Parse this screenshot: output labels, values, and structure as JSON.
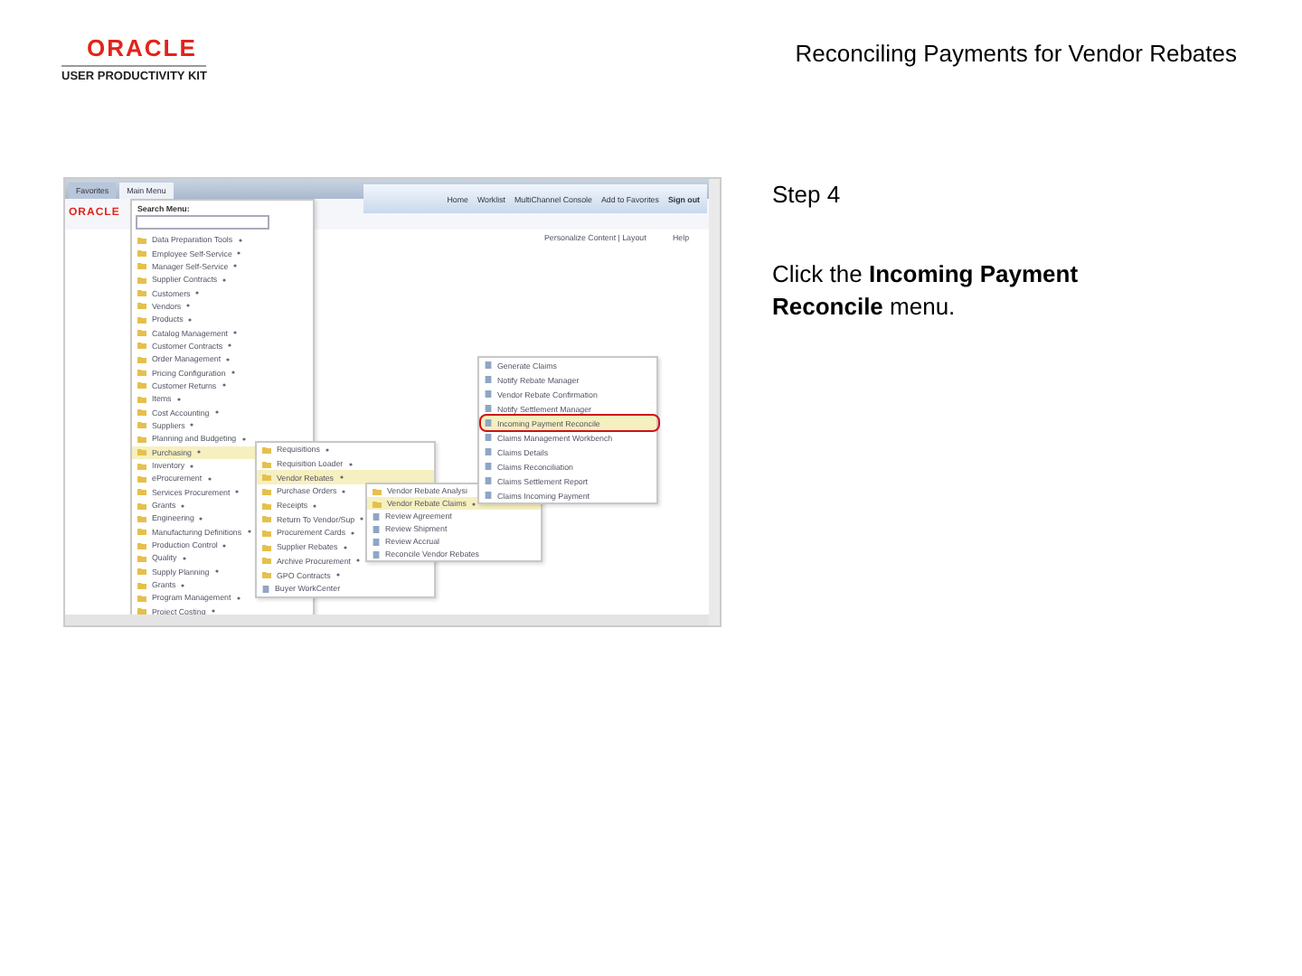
{
  "header": {
    "brand": "ORACLE",
    "product": "USER PRODUCTIVITY KIT",
    "title": "Reconciling Payments for Vendor Rebates"
  },
  "screenshot": {
    "nav_tabs": [
      {
        "label": "Favorites",
        "selected": false
      },
      {
        "label": "Main Menu",
        "selected": true
      }
    ],
    "brand": "ORACLE",
    "header_links": [
      "Home",
      "Worklist",
      "MultiChannel Console",
      "Add to Favorites",
      "Sign out"
    ],
    "personalize": "Personalize Content | Layout",
    "help": "Help",
    "search_label": "Search Menu:",
    "menus": [
      {
        "items": [
          {
            "label": "Data Preparation Tools",
            "kind": "folder",
            "selected": false,
            "arrow": true,
            "marked": false
          },
          {
            "label": "Employee Self-Service",
            "kind": "folder",
            "selected": false,
            "arrow": true,
            "marked": false
          },
          {
            "label": "Manager Self-Service",
            "kind": "folder",
            "selected": false,
            "arrow": true,
            "marked": false
          },
          {
            "label": "Supplier Contracts",
            "kind": "folder",
            "selected": false,
            "arrow": true,
            "marked": false
          },
          {
            "label": "Customers",
            "kind": "folder",
            "selected": false,
            "arrow": true,
            "marked": false
          },
          {
            "label": "Vendors",
            "kind": "folder",
            "selected": false,
            "arrow": true,
            "marked": false
          },
          {
            "label": "Products",
            "kind": "folder",
            "selected": false,
            "arrow": true,
            "marked": false
          },
          {
            "label": "Catalog Management",
            "kind": "folder",
            "selected": false,
            "arrow": true,
            "marked": false
          },
          {
            "label": "Customer Contracts",
            "kind": "folder",
            "selected": false,
            "arrow": true,
            "marked": false
          },
          {
            "label": "Order Management",
            "kind": "folder",
            "selected": false,
            "arrow": true,
            "marked": false
          },
          {
            "label": "Pricing Configuration",
            "kind": "folder",
            "selected": false,
            "arrow": true,
            "marked": false
          },
          {
            "label": "Customer Returns",
            "kind": "folder",
            "selected": false,
            "arrow": true,
            "marked": false
          },
          {
            "label": "Items",
            "kind": "folder",
            "selected": false,
            "arrow": true,
            "marked": false
          },
          {
            "label": "Cost Accounting",
            "kind": "folder",
            "selected": false,
            "arrow": true,
            "marked": false
          },
          {
            "label": "Suppliers",
            "kind": "folder",
            "selected": false,
            "arrow": true,
            "marked": false
          },
          {
            "label": "Planning and Budgeting",
            "kind": "folder",
            "selected": false,
            "arrow": true,
            "marked": false
          },
          {
            "label": "Purchasing",
            "kind": "folder",
            "selected": true,
            "arrow": true,
            "marked": false
          },
          {
            "label": "Inventory",
            "kind": "folder",
            "selected": false,
            "arrow": true,
            "marked": false
          },
          {
            "label": "eProcurement",
            "kind": "folder",
            "selected": false,
            "arrow": true,
            "marked": false
          },
          {
            "label": "Services Procurement",
            "kind": "folder",
            "selected": false,
            "arrow": true,
            "marked": false
          },
          {
            "label": "Grants",
            "kind": "folder",
            "selected": false,
            "arrow": true,
            "marked": false
          },
          {
            "label": "Engineering",
            "kind": "folder",
            "selected": false,
            "arrow": true,
            "marked": false
          },
          {
            "label": "Manufacturing Definitions",
            "kind": "folder",
            "selected": false,
            "arrow": true,
            "marked": false
          },
          {
            "label": "Production Control",
            "kind": "folder",
            "selected": false,
            "arrow": true,
            "marked": false
          },
          {
            "label": "Quality",
            "kind": "folder",
            "selected": false,
            "arrow": true,
            "marked": false
          },
          {
            "label": "Supply Planning",
            "kind": "folder",
            "selected": false,
            "arrow": true,
            "marked": false
          },
          {
            "label": "Grants",
            "kind": "folder",
            "selected": false,
            "arrow": true,
            "marked": false
          },
          {
            "label": "Program Management",
            "kind": "folder",
            "selected": false,
            "arrow": true,
            "marked": false
          },
          {
            "label": "Project Costing",
            "kind": "folder",
            "selected": false,
            "arrow": true,
            "marked": false
          }
        ]
      },
      {
        "items": [
          {
            "label": "Requisitions",
            "kind": "folder",
            "selected": false,
            "arrow": true,
            "marked": false
          },
          {
            "label": "Requisition Loader",
            "kind": "folder",
            "selected": false,
            "arrow": true,
            "marked": false
          },
          {
            "label": "Vendor Rebates",
            "kind": "folder",
            "selected": true,
            "arrow": true,
            "marked": false
          },
          {
            "label": "Purchase Orders",
            "kind": "folder",
            "selected": false,
            "arrow": true,
            "marked": false
          },
          {
            "label": "Receipts",
            "kind": "folder",
            "selected": false,
            "arrow": true,
            "marked": false
          },
          {
            "label": "Return To Vendor/Sup",
            "kind": "folder",
            "selected": false,
            "arrow": true,
            "marked": false
          },
          {
            "label": "Procurement Cards",
            "kind": "folder",
            "selected": false,
            "arrow": true,
            "marked": false
          },
          {
            "label": "Supplier Rebates",
            "kind": "folder",
            "selected": false,
            "arrow": true,
            "marked": false
          },
          {
            "label": "Archive Procurement",
            "kind": "folder",
            "selected": false,
            "arrow": true,
            "marked": false
          },
          {
            "label": "GPO Contracts",
            "kind": "folder",
            "selected": false,
            "arrow": true,
            "marked": false
          },
          {
            "label": "Buyer WorkCenter",
            "kind": "page",
            "selected": false,
            "arrow": false,
            "marked": false
          }
        ]
      },
      {
        "items": [
          {
            "label": "Vendor Rebate Analysi",
            "kind": "folder",
            "selected": false,
            "arrow": false,
            "marked": false
          },
          {
            "label": "Vendor Rebate Claims",
            "kind": "folder",
            "selected": true,
            "arrow": true,
            "marked": false
          },
          {
            "label": "Review Agreement",
            "kind": "page",
            "selected": false,
            "arrow": false,
            "marked": false
          },
          {
            "label": "Review Shipment",
            "kind": "page",
            "selected": false,
            "arrow": false,
            "marked": false
          },
          {
            "label": "Review Accrual",
            "kind": "page",
            "selected": false,
            "arrow": false,
            "marked": false
          },
          {
            "label": "Reconcile Vendor Rebates",
            "kind": "page",
            "selected": false,
            "arrow": false,
            "marked": false
          }
        ]
      },
      {
        "items": [
          {
            "label": "Generate Claims",
            "kind": "page",
            "selected": false,
            "arrow": false,
            "marked": false
          },
          {
            "label": "Notify Rebate Manager",
            "kind": "page",
            "selected": false,
            "arrow": false,
            "marked": false
          },
          {
            "label": "Vendor Rebate Confirmation",
            "kind": "page",
            "selected": false,
            "arrow": false,
            "marked": false
          },
          {
            "label": "Notify Settlement Manager",
            "kind": "page",
            "selected": false,
            "arrow": false,
            "marked": false
          },
          {
            "label": "Incoming Payment Reconcile",
            "kind": "page",
            "selected": true,
            "arrow": false,
            "marked": true
          },
          {
            "label": "Claims Management Workbench",
            "kind": "page",
            "selected": false,
            "arrow": false,
            "marked": false
          },
          {
            "label": "Claims Details",
            "kind": "page",
            "selected": false,
            "arrow": false,
            "marked": false
          },
          {
            "label": "Claims Reconciliation",
            "kind": "page",
            "selected": false,
            "arrow": false,
            "marked": false
          },
          {
            "label": "Claims Settlement Report",
            "kind": "page",
            "selected": false,
            "arrow": false,
            "marked": false
          },
          {
            "label": "Claims Incoming Payment",
            "kind": "page",
            "selected": false,
            "arrow": false,
            "marked": false
          }
        ]
      }
    ]
  },
  "instruction": {
    "step": "Step 4",
    "text": "Click the **Incoming Payment Reconcile** menu."
  }
}
